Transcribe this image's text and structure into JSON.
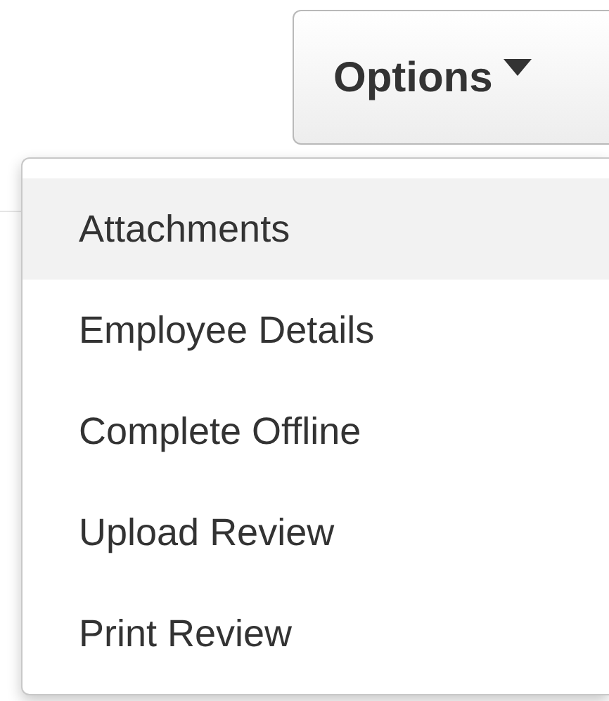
{
  "options_button": {
    "label": "Options"
  },
  "menu": [
    {
      "label": "Attachments",
      "selected": true
    },
    {
      "label": "Employee Details",
      "selected": false
    },
    {
      "label": "Complete Offline",
      "selected": false
    },
    {
      "label": "Upload Review",
      "selected": false
    },
    {
      "label": "Print Review",
      "selected": false
    }
  ]
}
